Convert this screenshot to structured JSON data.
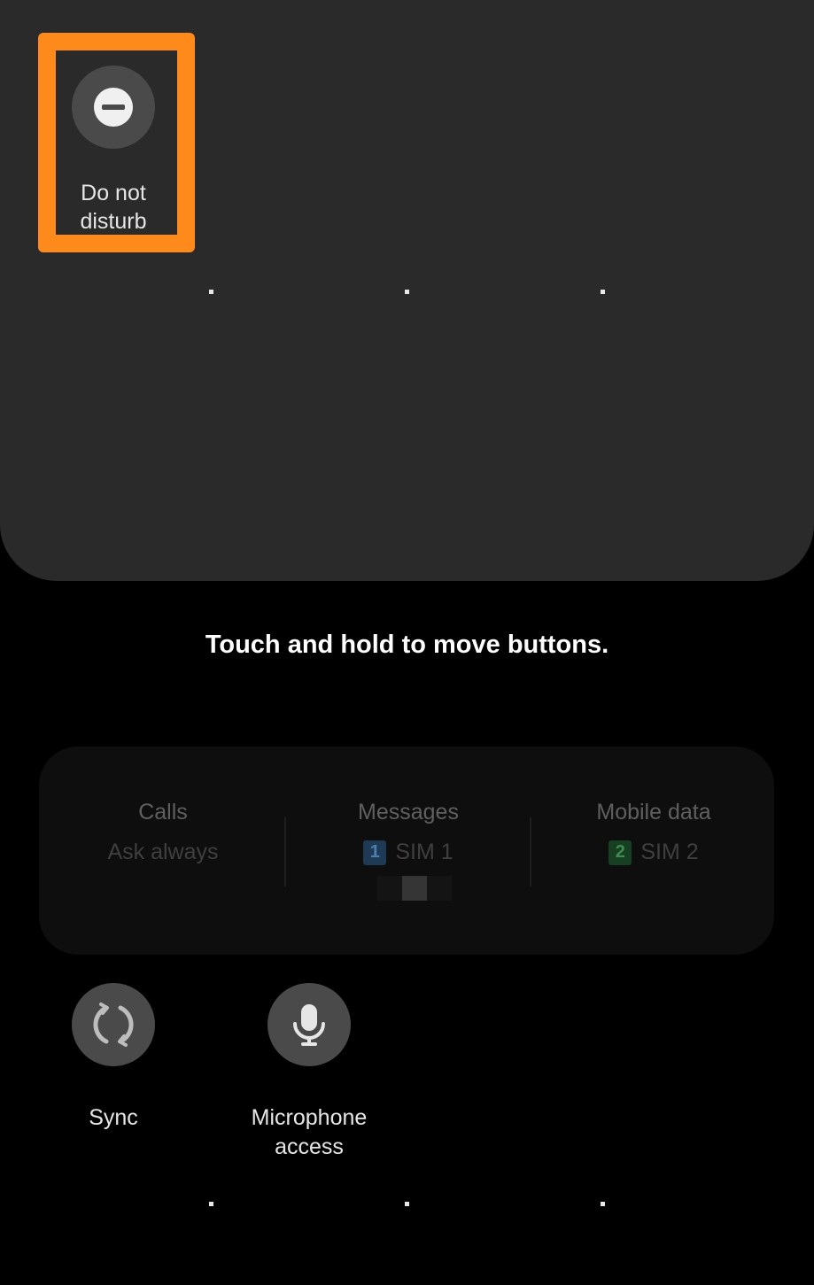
{
  "active_tiles": [
    {
      "label": "Do not\ndisturb",
      "icon": "minus-circle-icon"
    }
  ],
  "hint_text": "Touch and hold to move buttons.",
  "sim_card": {
    "calls": {
      "title": "Calls",
      "value": "Ask always"
    },
    "messages": {
      "title": "Messages",
      "sim_number": "1",
      "value": "SIM 1"
    },
    "mobile_data": {
      "title": "Mobile data",
      "sim_number": "2",
      "value": "SIM 2"
    }
  },
  "available_tiles": [
    {
      "label": "Sync",
      "icon": "sync-icon"
    },
    {
      "label": "Microphone\naccess",
      "icon": "microphone-icon"
    }
  ],
  "colors": {
    "highlight": "#ff8a1c",
    "panel": "#2a2a2a",
    "tile": "#4a4a4a"
  }
}
